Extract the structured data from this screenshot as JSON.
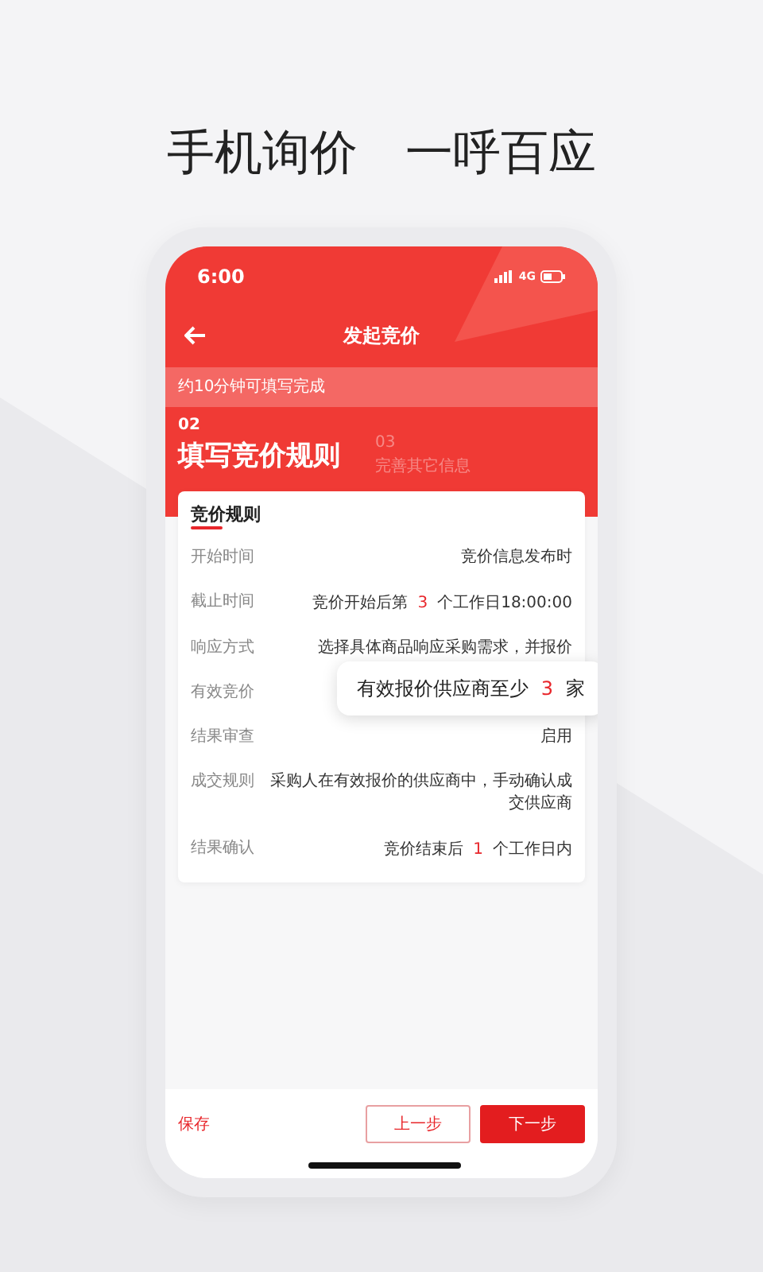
{
  "headline": [
    "手机询价",
    "一呼百应"
  ],
  "status_bar": {
    "time": "6:00",
    "network": "4G"
  },
  "nav": {
    "title": "发起竞价"
  },
  "notice": "约10分钟可填写完成",
  "steps": [
    {
      "number": "02",
      "label": "填写竞价规则",
      "selected": true
    },
    {
      "number": "03",
      "label": "完善其它信息",
      "selected": false
    }
  ],
  "card": {
    "title": "竞价规则",
    "rows": [
      {
        "kind": "text",
        "label": "开始时间",
        "value": "竞价信息发布时"
      },
      {
        "kind": "count",
        "label": "截止时间",
        "prefix": "竞价开始后第",
        "number": "3",
        "suffix": "个工作日18:00:00"
      },
      {
        "kind": "text",
        "label": "响应方式",
        "value": "选择具体商品响应采购需求，并报价"
      },
      {
        "kind": "callout",
        "label": "有效竞价",
        "prefix": "有效报价供应商至少",
        "number": "3",
        "suffix": "家"
      },
      {
        "kind": "text",
        "label": "结果审查",
        "value": "启用"
      },
      {
        "kind": "text",
        "label": "成交规则",
        "value": "采购人在有效报价的供应商中，手动确认成交供应商"
      },
      {
        "kind": "count",
        "label": "结果确认",
        "prefix": "竞价结束后",
        "number": "1",
        "suffix": "个工作日内"
      }
    ]
  },
  "footer": {
    "save": "保存",
    "prev": "上一步",
    "next": "下一步"
  }
}
